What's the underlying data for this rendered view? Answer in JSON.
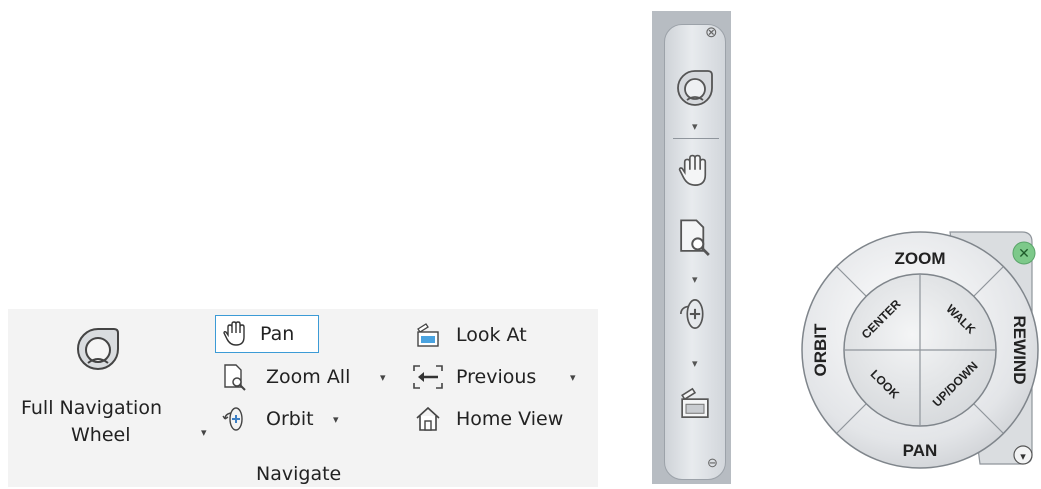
{
  "ribbon": {
    "full_nav_wheel_label_line1": "Full Navigation",
    "full_nav_wheel_label_line2": "Wheel",
    "pan_label": "Pan",
    "zoom_all_label": "Zoom All",
    "orbit_label": "Orbit",
    "look_at_label": "Look At",
    "previous_label": "Previous",
    "home_view_label": "Home View",
    "panel_title": "Navigate",
    "dropdown_glyph": "▾"
  },
  "navbar": {
    "close_glyph": "⊗",
    "dropdown_glyph": "▾",
    "options_glyph": "⊖"
  },
  "wheel": {
    "zoom": "ZOOM",
    "rewind": "REWIND",
    "pan": "PAN",
    "orbit": "ORBIT",
    "center": "CENTER",
    "walk": "WALK",
    "look": "LOOK",
    "updown": "UP/DOWN",
    "close_glyph": "✕",
    "menu_glyph": "▾",
    "close_color": "#7dc98a"
  }
}
